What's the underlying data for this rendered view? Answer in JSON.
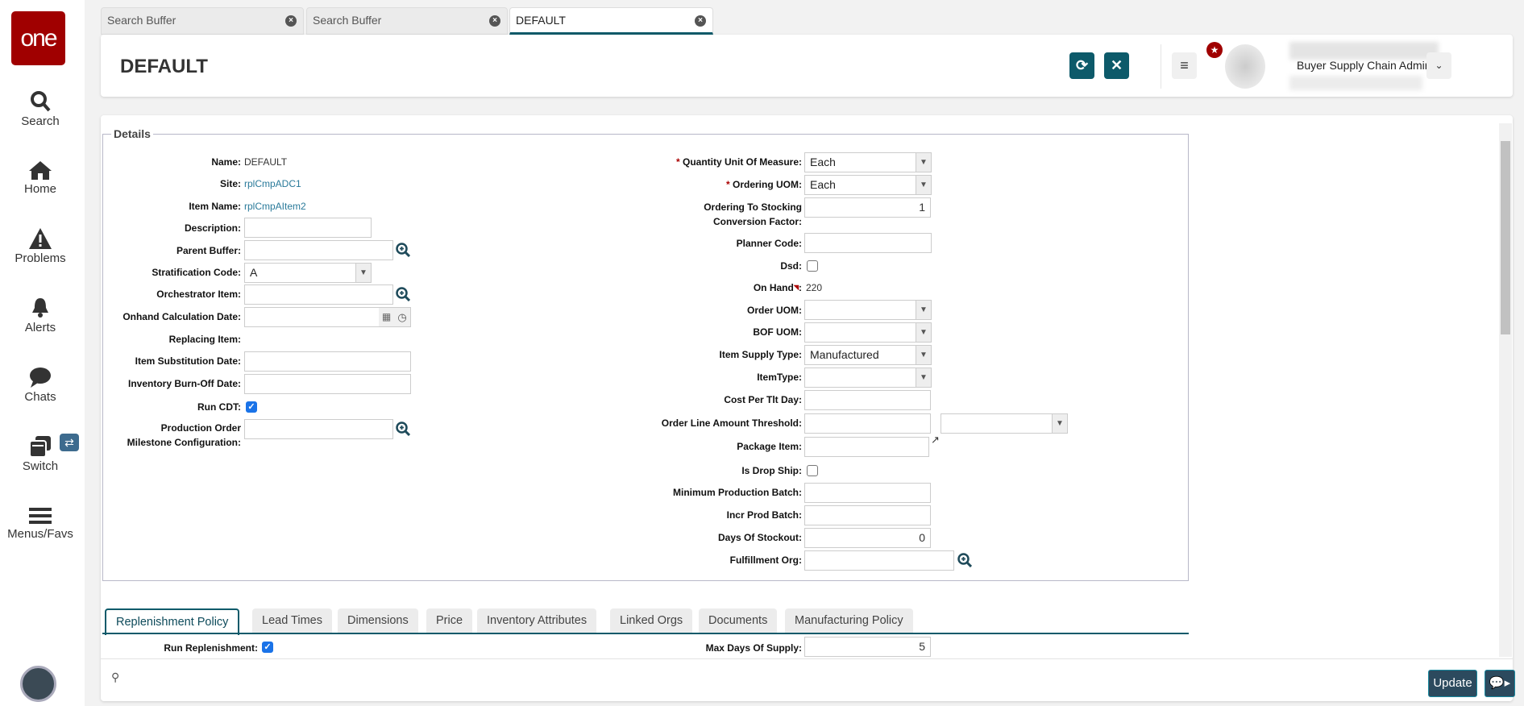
{
  "sidebar": {
    "logo": "one",
    "items": [
      {
        "label": "Search"
      },
      {
        "label": "Home"
      },
      {
        "label": "Problems"
      },
      {
        "label": "Alerts"
      },
      {
        "label": "Chats"
      },
      {
        "label": "Switch"
      },
      {
        "label": "Menus/Favs"
      }
    ]
  },
  "tabs": [
    {
      "label": "Search Buffer"
    },
    {
      "label": "Search Buffer"
    },
    {
      "label": "DEFAULT"
    }
  ],
  "header": {
    "title": "DEFAULT",
    "user_role": "Buyer Supply Chain Admin"
  },
  "details": {
    "legend": "Details",
    "left": {
      "name_label": "Name:",
      "name": "DEFAULT",
      "site_label": "Site:",
      "site": "rplCmpADC1",
      "item_label": "Item Name:",
      "item": "rplCmpAItem2",
      "description_label": "Description:",
      "parent_label": "Parent Buffer:",
      "strat_label": "Stratification Code:",
      "strat": "A",
      "orch_label": "Orchestrator Item:",
      "onhand_date_label": "Onhand Calculation Date:",
      "replacing_label": "Replacing Item:",
      "subst_label": "Item Substitution Date:",
      "burnoff_label": "Inventory Burn-Off Date:",
      "runcdt_label": "Run CDT:",
      "prod_label_1": "Production Order",
      "prod_label_2": "Milestone Configuration:"
    },
    "right": {
      "qty_uom_label": "Quantity Unit Of Measure:",
      "qty_uom": "Each",
      "ordering_uom_label": "Ordering UOM:",
      "ordering_uom": "Each",
      "conv_label_1": "Ordering To Stocking",
      "conv_label_2": "Conversion Factor:",
      "conv": "1",
      "planner_label": "Planner Code:",
      "dsd_label": "Dsd:",
      "onhand_label": "On Hand",
      "onhand": "220",
      "order_uom_label": "Order UOM:",
      "bof_label": "BOF UOM:",
      "supply_label": "Item Supply Type:",
      "supply": "Manufactured",
      "itemtype_label": "ItemType:",
      "cost_label": "Cost Per Tlt Day:",
      "threshold_label": "Order Line Amount Threshold:",
      "package_label": "Package Item:",
      "dropship_label": "Is Drop Ship:",
      "minprod_label": "Minimum Production Batch:",
      "incr_label": "Incr Prod Batch:",
      "stockout_label": "Days Of Stockout:",
      "stockout": "0",
      "fulfill_label": "Fulfillment Org:",
      "required_mark": "*"
    }
  },
  "bottom_tabs": [
    {
      "label": "Replenishment Policy"
    },
    {
      "label": "Lead Times"
    },
    {
      "label": "Dimensions"
    },
    {
      "label": "Price"
    },
    {
      "label": "Inventory Attributes"
    },
    {
      "label": "Linked Orgs"
    },
    {
      "label": "Documents"
    },
    {
      "label": "Manufacturing Policy"
    }
  ],
  "replenishment": {
    "run_label": "Run Replenishment:",
    "max_days_label": "Max Days Of Supply:",
    "max_days": "5"
  },
  "footer": {
    "update": "Update"
  }
}
